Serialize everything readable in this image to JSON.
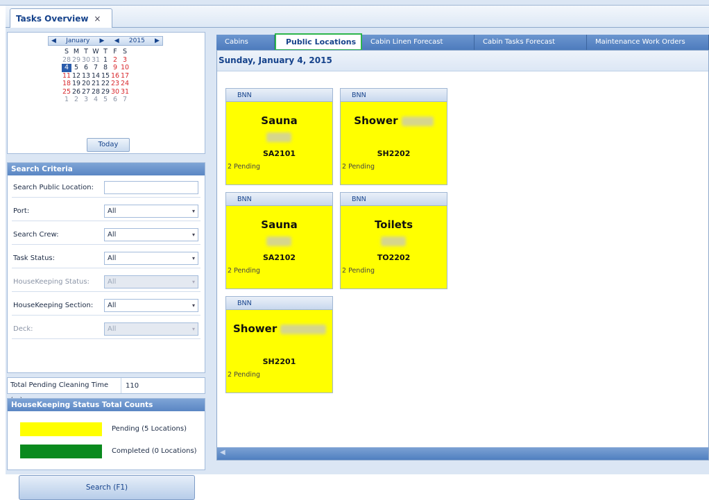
{
  "doc_tab": {
    "title": "Tasks Overview",
    "close": "×"
  },
  "calendar": {
    "prev_month": "◀",
    "month": "January",
    "next_month": "▶",
    "prev_year": "◀",
    "year": "2015",
    "next_year": "▶",
    "weekdays": [
      "S",
      "M",
      "T",
      "W",
      "T",
      "F",
      "S"
    ],
    "weeks": [
      [
        "28",
        "29",
        "30",
        "31",
        "1",
        "2",
        "3"
      ],
      [
        "4",
        "5",
        "6",
        "7",
        "8",
        "9",
        "10"
      ],
      [
        "11",
        "12",
        "13",
        "14",
        "15",
        "16",
        "17"
      ],
      [
        "18",
        "19",
        "20",
        "21",
        "22",
        "23",
        "24"
      ],
      [
        "25",
        "26",
        "27",
        "28",
        "29",
        "30",
        "31"
      ],
      [
        "1",
        "2",
        "3",
        "4",
        "5",
        "6",
        "7"
      ]
    ],
    "selected_day": "4",
    "today_label": "Today"
  },
  "search": {
    "title": "Search Criteria",
    "fields": [
      {
        "label": "Search Public Location:",
        "value": "",
        "type": "text",
        "disabled": false
      },
      {
        "label": "Port:",
        "value": "All",
        "type": "select",
        "disabled": false
      },
      {
        "label": "Search Crew:",
        "value": "All",
        "type": "select",
        "disabled": false
      },
      {
        "label": "Task Status:",
        "value": "All",
        "type": "select",
        "disabled": false
      },
      {
        "label": "HouseKeeping Status:",
        "value": "All",
        "type": "select",
        "disabled": true
      },
      {
        "label": "HouseKeeping Section:",
        "value": "All",
        "type": "select",
        "disabled": false
      },
      {
        "label": "Deck:",
        "value": "All",
        "type": "select",
        "disabled": true
      }
    ],
    "button": "Search (F1)"
  },
  "pending_time": {
    "label": "Total Pending Cleaning Time (m)",
    "value": "110"
  },
  "hk_counts": {
    "title": "HouseKeeping Status Total Counts",
    "items": [
      {
        "label": "Pending (5 Locations)",
        "color": "#ffff00"
      },
      {
        "label": "Completed (0 Locations)",
        "color": "#0a8a1e"
      }
    ]
  },
  "tabs": [
    {
      "label": "Cabins",
      "active": false
    },
    {
      "label": "Public Locations",
      "active": true
    },
    {
      "label": "Cabin Linen Forecast",
      "active": false
    },
    {
      "label": "Cabin Tasks Forecast",
      "active": false
    },
    {
      "label": "Maintenance Work Orders",
      "active": false
    }
  ],
  "date_heading": "Sunday, January 4, 2015",
  "cards": [
    {
      "header": "BNN",
      "name": "Sauna",
      "code": "SA2101",
      "status": "2 Pending",
      "color": "#ffff00"
    },
    {
      "header": "BNN",
      "name": "Shower",
      "code": "SH2202",
      "status": "2 Pending",
      "color": "#ffff00"
    },
    {
      "header": "BNN",
      "name": "Sauna",
      "code": "SA2102",
      "status": "2 Pending",
      "color": "#ffff00"
    },
    {
      "header": "BNN",
      "name": "Toilets",
      "code": "TO2202",
      "status": "2 Pending",
      "color": "#ffff00"
    },
    {
      "header": "BNN",
      "name": "Shower",
      "code": "SH2201",
      "status": "2 Pending",
      "color": "#ffff00"
    }
  ],
  "scroll_left": "◀"
}
